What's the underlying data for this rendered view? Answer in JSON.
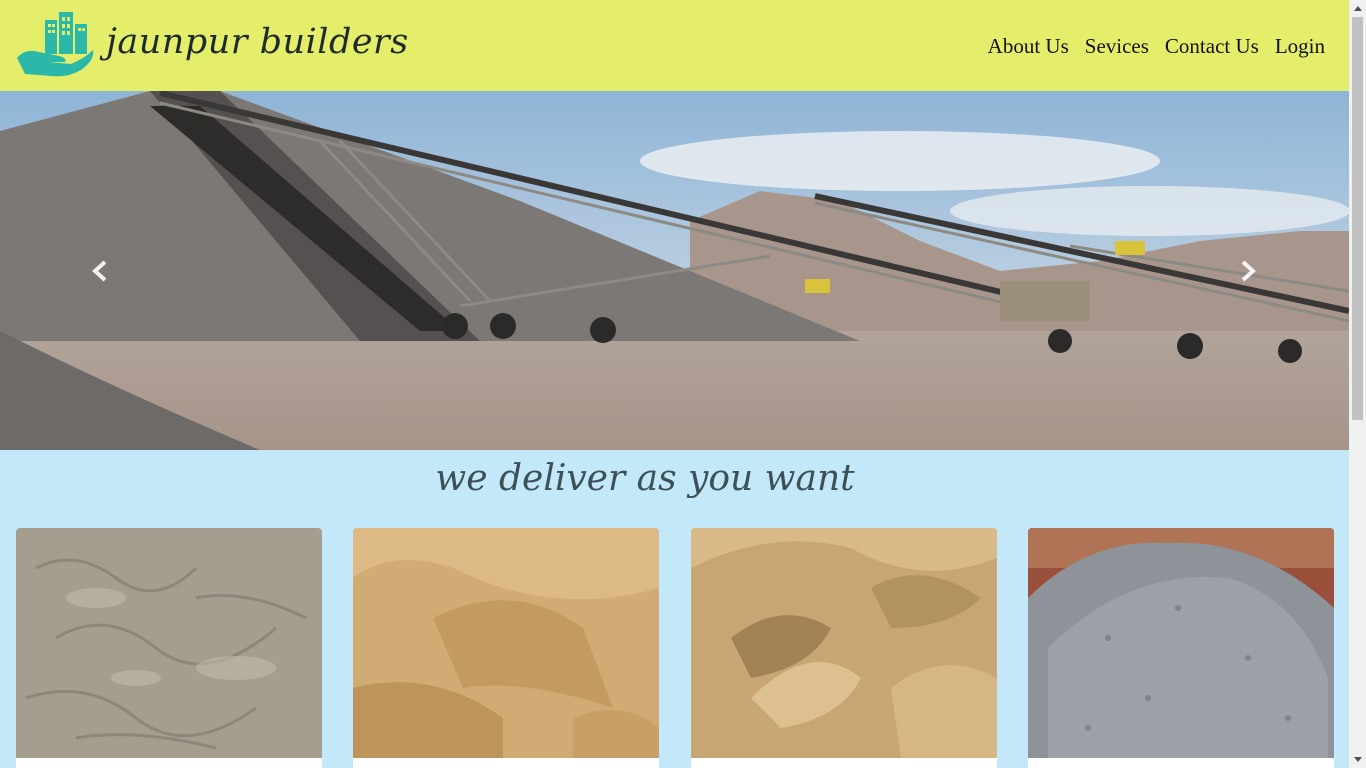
{
  "brand": {
    "name": "jaunpur builders",
    "logo_icon": "hand-buildings-icon",
    "accent": "#2bb8a8"
  },
  "nav": {
    "items": [
      {
        "label": "About Us"
      },
      {
        "label": "Sevices"
      },
      {
        "label": "Contact Us"
      },
      {
        "label": "Login"
      }
    ],
    "background": "#e5ee6b"
  },
  "carousel": {
    "prev_icon": "chevron-left-icon",
    "next_icon": "chevron-right-icon"
  },
  "tagline": "we deliver as you want",
  "products": [
    {
      "icon": "grey-sand-image"
    },
    {
      "icon": "yellow-sand-image"
    },
    {
      "icon": "fine-sand-image"
    },
    {
      "icon": "gravel-image"
    }
  ],
  "page_background": "#c3e8f9"
}
